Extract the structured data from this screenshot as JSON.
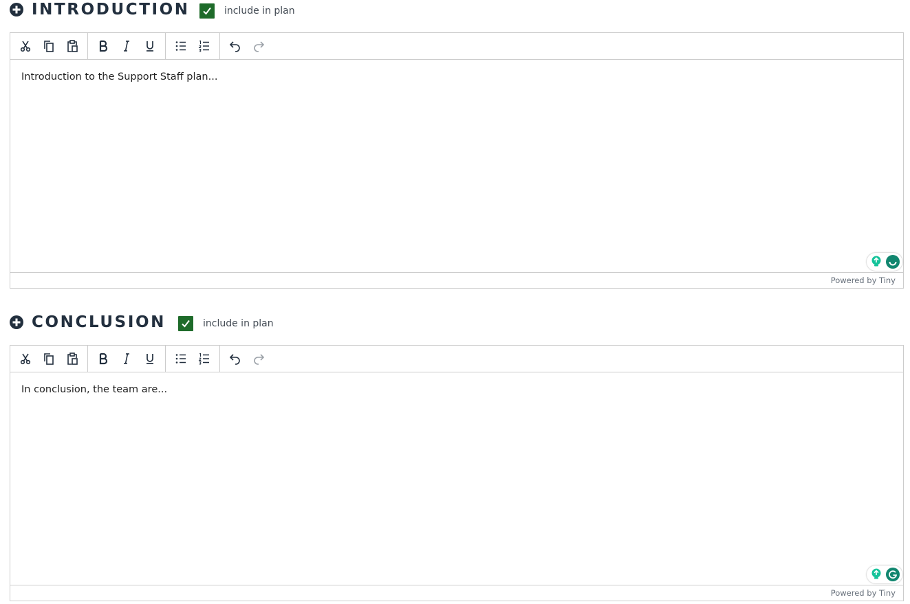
{
  "sections": [
    {
      "title": "INTRODUCTION",
      "include_label": "include in plan",
      "include_checked": true,
      "content": "Introduction to the Support Staff plan...",
      "status_bar": "Powered by Tiny"
    },
    {
      "title": "CONCLUSION",
      "include_label": "include in plan",
      "include_checked": true,
      "content": "In conclusion, the team are...",
      "status_bar": "Powered by Tiny"
    }
  ],
  "toolbar_icons": [
    "cut-icon",
    "copy-icon",
    "paste-icon",
    "bold-icon",
    "italic-icon",
    "underline-icon",
    "bullet-list-icon",
    "numbered-list-icon",
    "undo-icon",
    "redo-icon"
  ],
  "colors": {
    "checkbox_green": "#1e6b2a",
    "grammarly_green": "#15c39a",
    "title_color": "#222f3e"
  }
}
